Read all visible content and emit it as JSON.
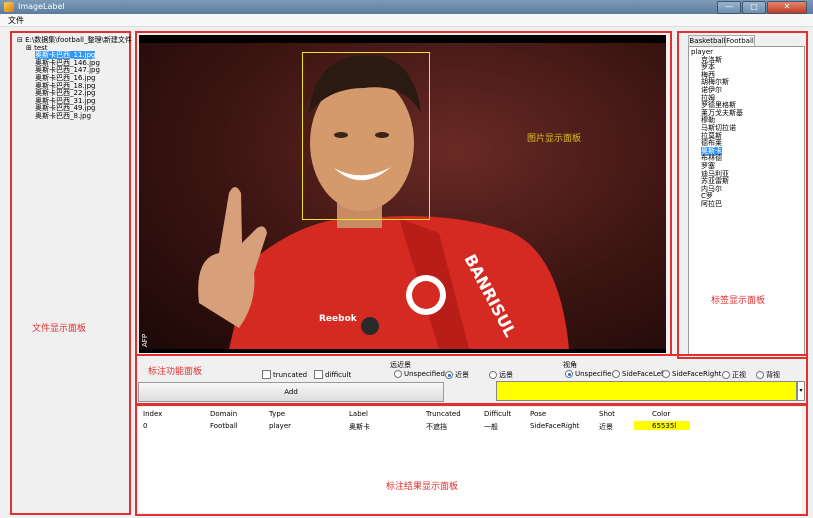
{
  "window": {
    "title": "ImageLabel",
    "min": "—",
    "max": "□",
    "close": "✕"
  },
  "menu": {
    "file": "文件"
  },
  "files": {
    "root": "E:\\数据集\\football_整理\\新建文件",
    "folder": "test",
    "items": [
      "奥斯卡巴西_11.jpg",
      "奥斯卡巴西_146.jpg",
      "奥斯卡巴西_147.jpg",
      "奥斯卡巴西_16.jpg",
      "奥斯卡巴西_18.jpg",
      "奥斯卡巴西_22.jpg",
      "奥斯卡巴西_31.jpg",
      "奥斯卡巴西_49.jpg",
      "奥斯卡巴西_8.jpg"
    ],
    "selected_index": 0
  },
  "panels": {
    "file": "文件显示面板",
    "image": "图片显示面板",
    "tag": "标签显示面板",
    "function": "标注功能面板",
    "result": "标注结果显示面板"
  },
  "tags": {
    "tabs": [
      "Basketball",
      "Football"
    ],
    "active_tab": 1,
    "root": "player",
    "items": [
      "克洛斯",
      "罗本",
      "梅西",
      "胡梅尔斯",
      "诺伊尔",
      "拉姆",
      "罗德里格斯",
      "莱万戈夫斯基",
      "穆勒",
      "马斯切拉诺",
      "拉莫斯",
      "德布莱",
      "奥斯卡",
      "布林德",
      "罗塞",
      "迪马利亚",
      "苏亚雷斯",
      "内马尔",
      "C罗",
      "阿拉巴"
    ],
    "selected_index": 12
  },
  "controls": {
    "truncated": "truncated",
    "difficult": "difficult",
    "shot_title": "远近景",
    "shot_options": [
      "Unspecified",
      "近景",
      "远景"
    ],
    "shot_selected": 1,
    "pose_title": "视角",
    "pose_options": [
      "Unspecified",
      "SideFaceLeft",
      "SideFaceRight",
      "正视",
      "背视"
    ],
    "pose_selected": 0,
    "add": "Add",
    "color_hex": "#ffff00"
  },
  "table": {
    "headers": [
      "Index",
      "Domain",
      "Type",
      "Label",
      "Truncated",
      "Difficult",
      "Pose",
      "Shot",
      "Color"
    ],
    "rows": [
      [
        "0",
        "Football",
        "player",
        "奥斯卡",
        "不遮挡",
        "一般",
        "SideFaceRight",
        "近景",
        "65535l"
      ]
    ],
    "highlight_color": "#ffff00"
  },
  "colors": {
    "panel_border": "#e03030",
    "selection": "#3399ff"
  }
}
